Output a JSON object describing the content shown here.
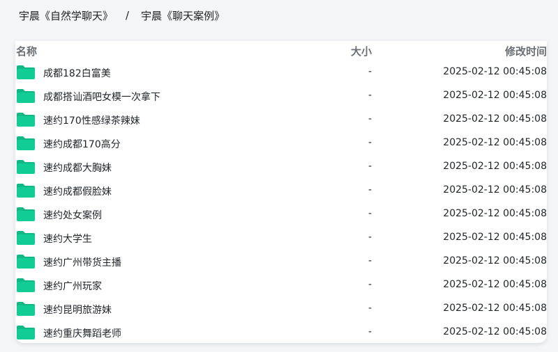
{
  "breadcrumb": {
    "items": [
      "宇晨《自然学聊天》",
      "宇晨《聊天案例》"
    ],
    "separator": "/"
  },
  "table": {
    "columns": {
      "name": "名称",
      "size": "大小",
      "modified": "修改时间"
    },
    "rows": [
      {
        "name": "成都182白富美",
        "size": "-",
        "modified": "2025-02-12 00:45:08"
      },
      {
        "name": "成都搭讪酒吧女模一次拿下",
        "size": "-",
        "modified": "2025-02-12 00:45:08"
      },
      {
        "name": "速约170性感绿茶辣妹",
        "size": "-",
        "modified": "2025-02-12 00:45:08"
      },
      {
        "name": "速约成都170高分",
        "size": "-",
        "modified": "2025-02-12 00:45:08"
      },
      {
        "name": "速约成都大胸妹",
        "size": "-",
        "modified": "2025-02-12 00:45:08"
      },
      {
        "name": "速约成都假脸妹",
        "size": "-",
        "modified": "2025-02-12 00:45:08"
      },
      {
        "name": "速约处女案例",
        "size": "-",
        "modified": "2025-02-12 00:45:08"
      },
      {
        "name": "速约大学生",
        "size": "-",
        "modified": "2025-02-12 00:45:08"
      },
      {
        "name": "速约广州带货主播",
        "size": "-",
        "modified": "2025-02-12 00:45:08"
      },
      {
        "name": "速约广州玩家",
        "size": "-",
        "modified": "2025-02-12 00:45:08"
      },
      {
        "name": "速约昆明旅游妹",
        "size": "-",
        "modified": "2025-02-12 00:45:08"
      },
      {
        "name": "速约重庆舞蹈老师",
        "size": "-",
        "modified": "2025-02-12 00:45:08"
      }
    ]
  },
  "icons": {
    "row_icon": "folder-icon"
  },
  "colors": {
    "folder": "#11cc94",
    "folder_tab": "#0fb884",
    "background": "#f4f5f7",
    "panel": "#ffffff",
    "header_text": "#6b6f75"
  }
}
